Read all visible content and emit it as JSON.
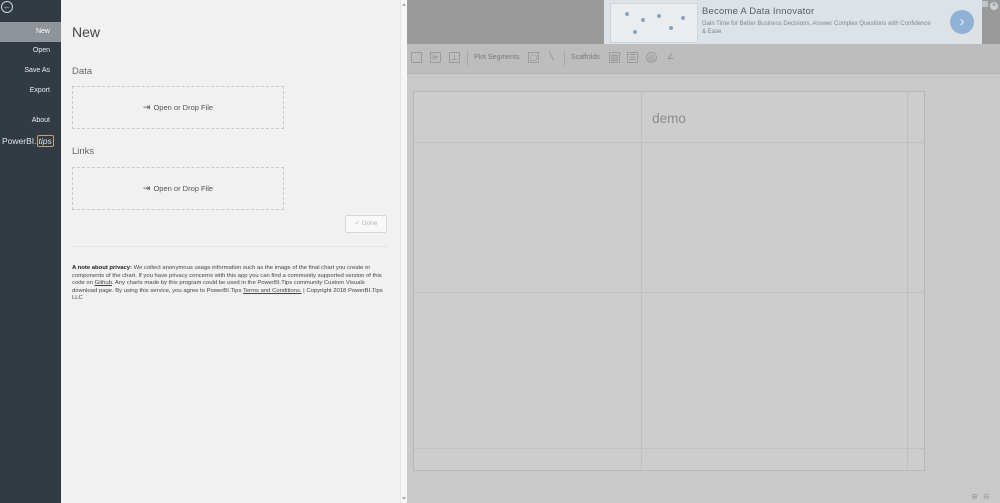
{
  "ad": {
    "title": "Become A Data Innovator",
    "subtitle": "Gain Time for Better Business Decisions, Answer Complex Questions with Confidence & Ease"
  },
  "nav": {
    "items": [
      {
        "label": "New",
        "active": true
      },
      {
        "label": "Open",
        "active": false
      },
      {
        "label": "Save As",
        "active": false
      },
      {
        "label": "Export",
        "active": false
      },
      {
        "label": "About",
        "active": false
      }
    ],
    "brand_prefix": "PowerBI.",
    "brand_suffix": "tips"
  },
  "panel": {
    "title": "New",
    "data_section": "Data",
    "links_section": "Links",
    "open_drop_label": "Open or Drop File",
    "done_label": "Done"
  },
  "privacy": {
    "heading": "A note about privacy:",
    "text_before_github": " We collect anonymous usage information such as the image of the final chart you create or components of the chart. If you have privacy concerns with this app you can find a community supported version of this code on ",
    "github_link": "Github",
    "text_after_github": ". Any charts made by this program could be used in the PowerBI.Tips community Custom Visuals download page. By using this service, you agree to PowerBI.Tips ",
    "terms_link": "Terms and Conditions.",
    "copyright": " | Copyright 2018 PowerBI.Tips LLC"
  },
  "toolbar": {
    "plot_segments": "Plot Segments",
    "scaffolds": "Scaffolds"
  },
  "canvas": {
    "title": "demo"
  },
  "icons": {
    "back": "back-arrow-icon",
    "open_file": "sign-in-icon",
    "done": "check-icon"
  }
}
